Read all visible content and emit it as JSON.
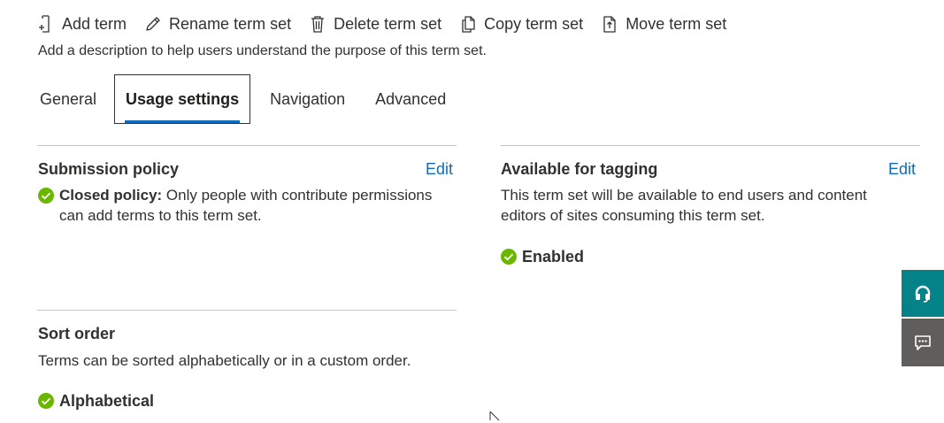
{
  "toolbar": {
    "add_term": "Add term",
    "rename_term_set": "Rename term set",
    "delete_term_set": "Delete term set",
    "copy_term_set": "Copy term set",
    "move_term_set": "Move term set"
  },
  "description": "Add a description to help users understand the purpose of this term set.",
  "tabs": [
    {
      "label": "General",
      "active": false
    },
    {
      "label": "Usage settings",
      "active": true
    },
    {
      "label": "Navigation",
      "active": false
    },
    {
      "label": "Advanced",
      "active": false
    }
  ],
  "submission_policy": {
    "title": "Submission policy",
    "edit": "Edit",
    "status_bold": "Closed policy:",
    "status_text": " Only people with contribute permissions can add terms to this term set."
  },
  "available_for_tagging": {
    "title": "Available for tagging",
    "edit": "Edit",
    "text": "This term set will be available to end users and content editors of sites consuming this term set.",
    "status": "Enabled"
  },
  "sort_order": {
    "title": "Sort order",
    "text": "Terms can be sorted alphabetically or in a custom order.",
    "status": "Alphabetical"
  },
  "colors": {
    "accent": "#0f6cbd",
    "success": "#6bb700",
    "side_support": "#038387",
    "side_feedback": "#605e5c"
  },
  "icons": {
    "add_term": "add-term-icon",
    "rename": "pencil-icon",
    "delete": "trash-icon",
    "copy": "copy-icon",
    "move": "move-icon",
    "check": "check-circle-icon",
    "support": "headset-icon",
    "feedback": "feedback-icon"
  }
}
